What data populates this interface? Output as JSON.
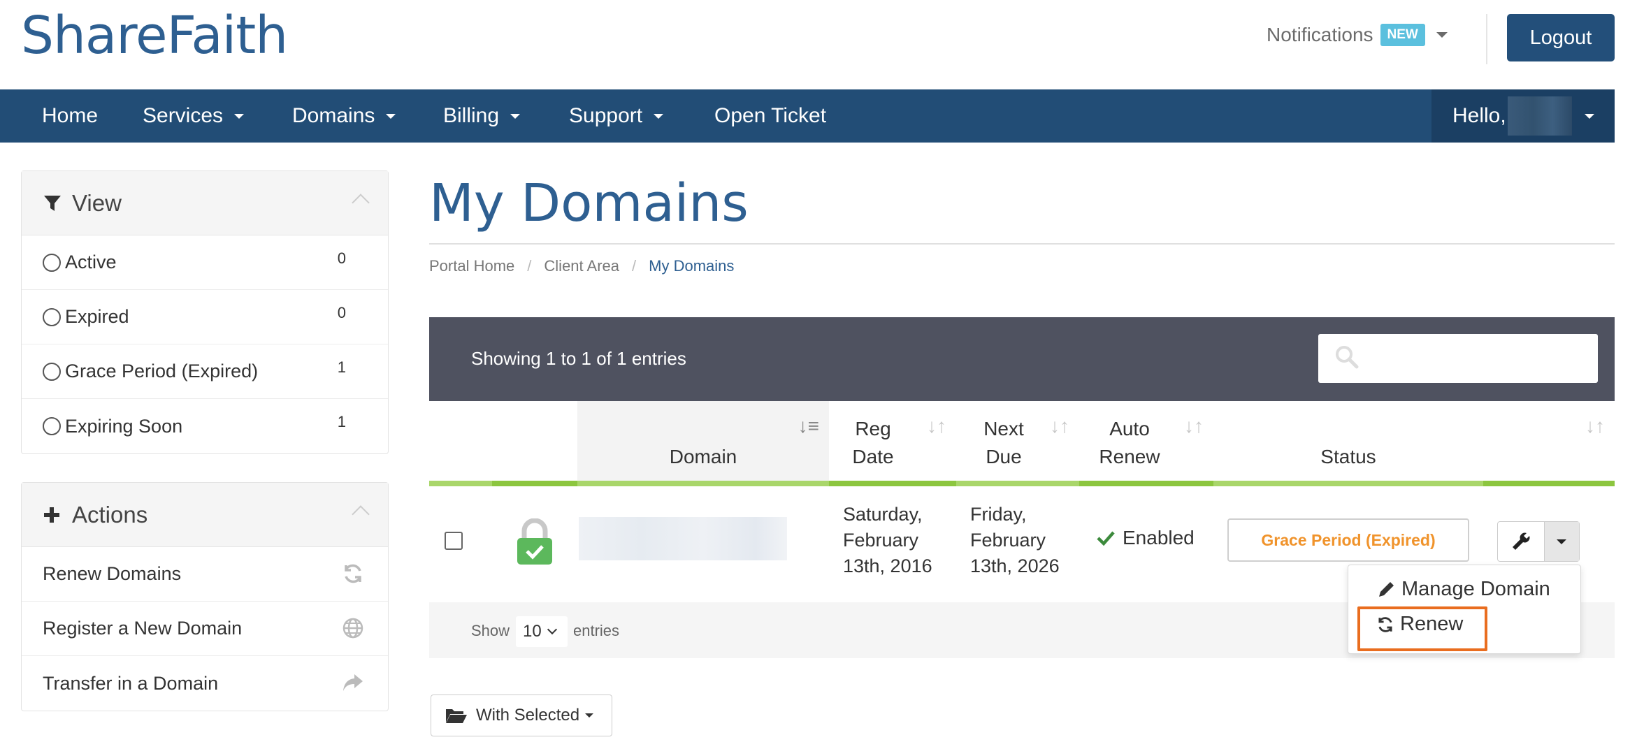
{
  "header": {
    "logo": "ShareFaith",
    "notifications_label": "Notifications",
    "notifications_badge": "NEW",
    "logout_label": "Logout"
  },
  "navbar": {
    "items": [
      {
        "label": "Home"
      },
      {
        "label": "Services"
      },
      {
        "label": "Domains"
      },
      {
        "label": "Billing"
      },
      {
        "label": "Support"
      },
      {
        "label": "Open Ticket"
      }
    ],
    "hello_label": "Hello,"
  },
  "sidebar": {
    "view": {
      "title": "View",
      "items": [
        {
          "label": "Active",
          "count": "0"
        },
        {
          "label": "Expired",
          "count": "0"
        },
        {
          "label": "Grace Period (Expired)",
          "count": "1"
        },
        {
          "label": "Expiring Soon",
          "count": "1"
        }
      ]
    },
    "actions": {
      "title": "Actions",
      "items": [
        {
          "label": "Renew Domains",
          "icon": "refresh-icon"
        },
        {
          "label": "Register a New Domain",
          "icon": "globe-icon"
        },
        {
          "label": "Transfer in a Domain",
          "icon": "share-icon"
        }
      ]
    }
  },
  "main": {
    "title": "My Domains",
    "breadcrumb": [
      "Portal Home",
      "Client Area",
      "My Domains"
    ],
    "table": {
      "showing": "Showing 1 to 1 of 1 entries",
      "columns": {
        "domain": "Domain",
        "reg_date_1": "Reg",
        "reg_date_2": "Date",
        "next_due_1": "Next",
        "next_due_2": "Due",
        "auto_renew_1": "Auto",
        "auto_renew_2": "Renew",
        "status": "Status"
      },
      "rows": [
        {
          "reg_date": [
            "Saturday,",
            "February",
            "13th, 2016"
          ],
          "next_due": [
            "Friday,",
            "February",
            "13th, 2026"
          ],
          "auto_renew": "Enabled",
          "status": "Grace Period (Expired)"
        }
      ],
      "show_label": "Show",
      "page_size": "10",
      "entries_label": "entries"
    },
    "dropdown": {
      "manage": "Manage Domain",
      "renew": "Renew"
    },
    "with_selected": "With Selected"
  },
  "colors": {
    "brand": "#2e5f91",
    "navbar": "#224d76",
    "table_header": "#4f5260",
    "accent_green": "#8cc63f",
    "status_orange": "#f0932b",
    "highlight": "#e96d1f"
  }
}
